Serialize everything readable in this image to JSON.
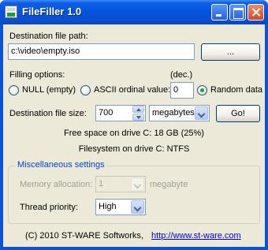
{
  "window": {
    "title": "FileFiller 1.0"
  },
  "dest_path": {
    "label": "Destination file path:",
    "value": "c:\\video\\empty.iso",
    "browse_label": "..."
  },
  "filling": {
    "label": "Filling options:",
    "dec_label": "(dec.)",
    "options": [
      {
        "label": "NULL (empty)",
        "checked": false
      },
      {
        "label": "ASCII ordinal value:",
        "checked": false
      },
      {
        "label": "Random data",
        "checked": true
      }
    ],
    "ascii_value": "0"
  },
  "size": {
    "label": "Destination file size:",
    "value": "700",
    "unit": "megabytes",
    "go_label": "Go!"
  },
  "info": {
    "free_space": "Free space on drive C: 18 GB (25%)",
    "filesystem": "Filesystem on drive C: NTFS"
  },
  "misc": {
    "title": "Miscellaneous settings",
    "memory_label": "Memory allocation:",
    "memory_value": "1",
    "memory_unit": "megabyte",
    "thread_label": "Thread priority:",
    "thread_value": "High"
  },
  "footer": {
    "copyright": "(C) 2010 ST-WARE Softworks,",
    "link": "http://www.st-ware.com"
  },
  "colors": {
    "titlebar": "#0553dc",
    "client": "#ece9d8",
    "group_title": "#0046d5",
    "radio_check": "#22a031"
  }
}
